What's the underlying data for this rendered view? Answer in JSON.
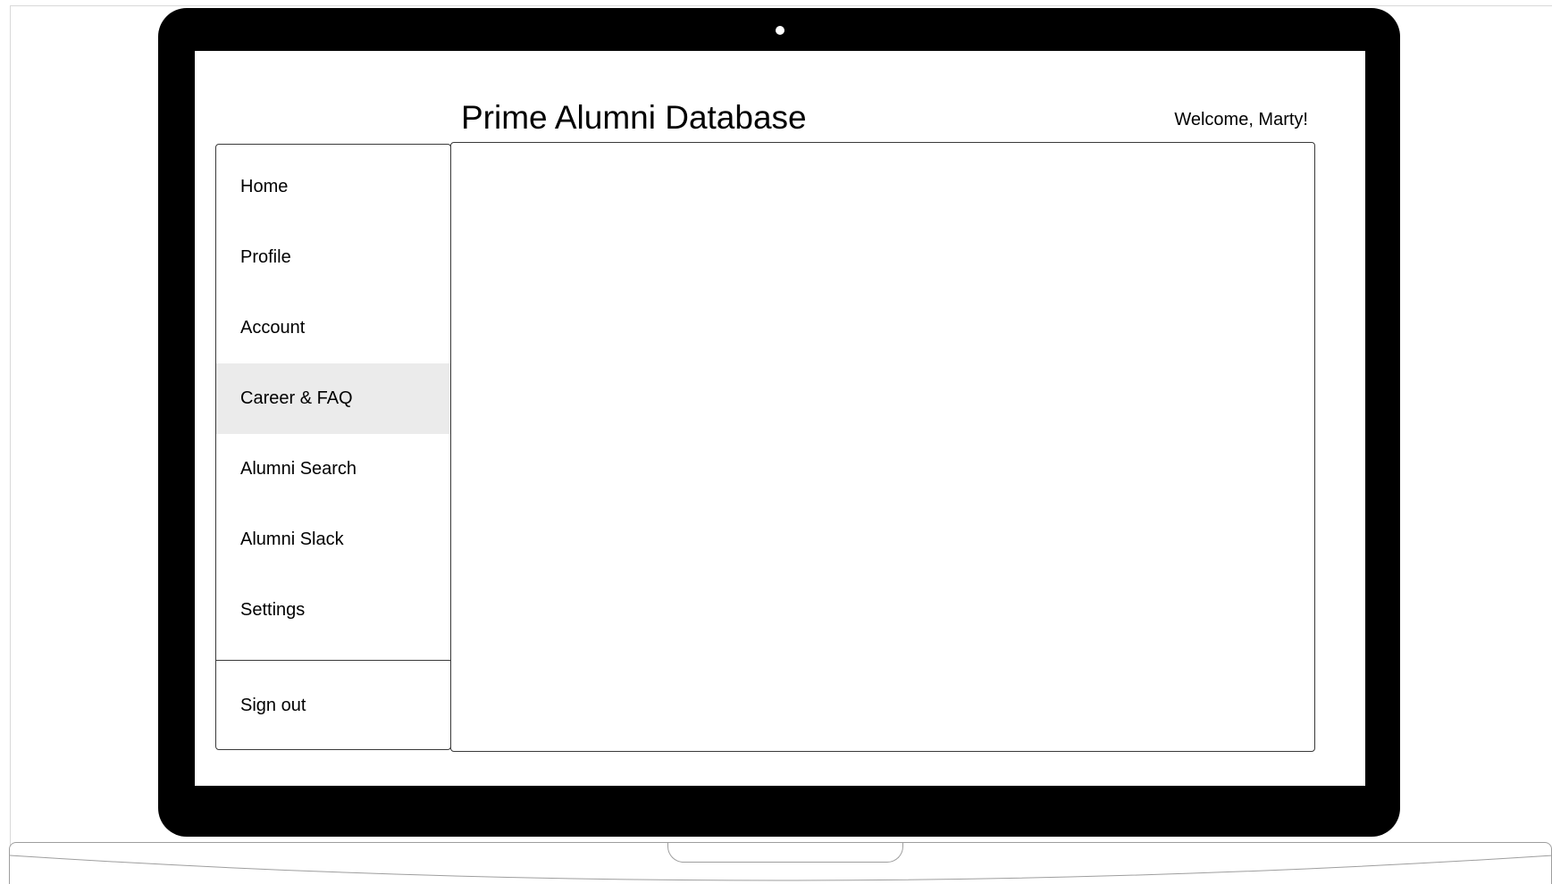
{
  "app": {
    "title": "Prime Alumni Database",
    "welcome": "Welcome, Marty!"
  },
  "sidebar": {
    "items": [
      {
        "label": "Home",
        "active": false
      },
      {
        "label": "Profile",
        "active": false
      },
      {
        "label": "Account",
        "active": false
      },
      {
        "label": "Career & FAQ",
        "active": true
      },
      {
        "label": "Alumni Search",
        "active": false
      },
      {
        "label": "Alumni Slack",
        "active": false
      },
      {
        "label": "Settings",
        "active": false
      }
    ],
    "signout_label": "Sign out"
  },
  "colors": {
    "bezel": "#000000",
    "active_item_bg": "#ebebeb",
    "border": "#3a3a3a"
  }
}
